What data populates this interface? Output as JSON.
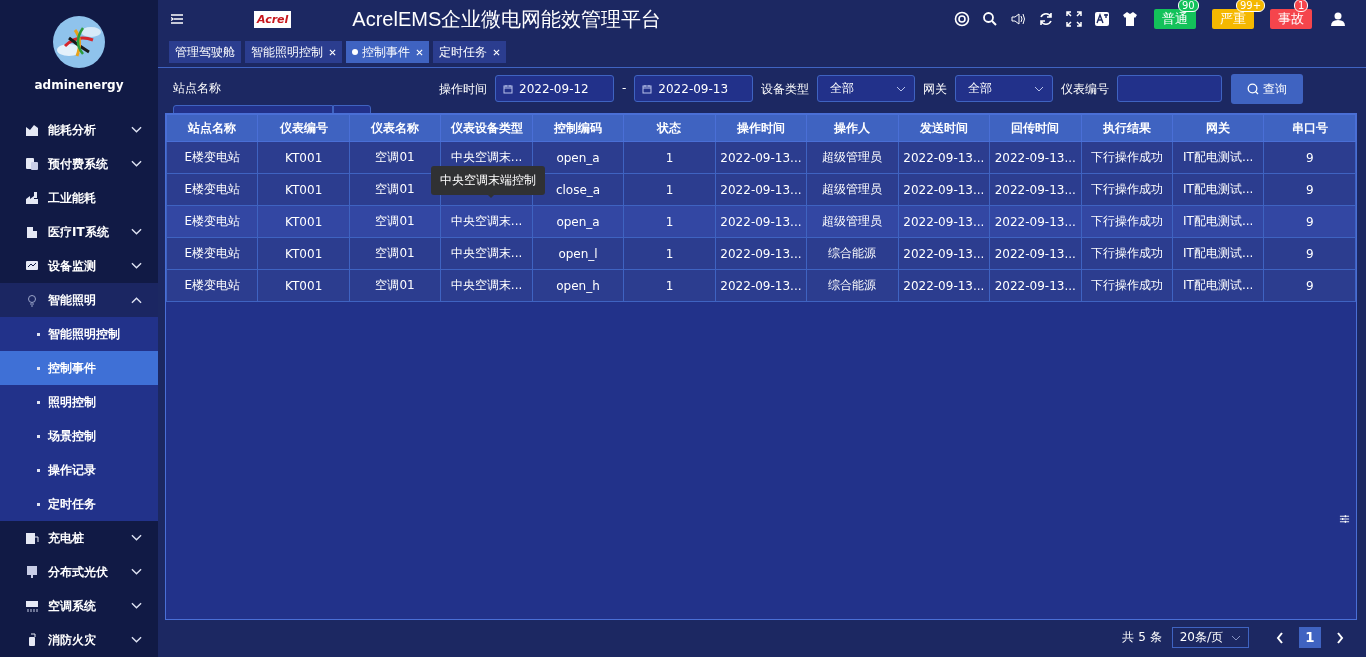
{
  "user": {
    "name": "adminenergy"
  },
  "menu": [
    {
      "label": "能耗分析",
      "expanded": false
    },
    {
      "label": "预付费系统",
      "expanded": false
    },
    {
      "label": "工业能耗"
    },
    {
      "label": "医疗IT系统",
      "expanded": false
    },
    {
      "label": "设备监测",
      "expanded": false
    },
    {
      "label": "智能照明",
      "expanded": true,
      "children": [
        {
          "label": "智能照明控制",
          "selected": false
        },
        {
          "label": "控制事件",
          "selected": true
        },
        {
          "label": "照明控制",
          "selected": false
        },
        {
          "label": "场景控制",
          "selected": false
        },
        {
          "label": "操作记录",
          "selected": false
        },
        {
          "label": "定时任务",
          "selected": false
        }
      ]
    },
    {
      "label": "充电桩",
      "expanded": false
    },
    {
      "label": "分布式光伏",
      "expanded": false
    },
    {
      "label": "空调系统",
      "expanded": false
    },
    {
      "label": "消防火灾",
      "expanded": false
    }
  ],
  "header": {
    "logo": "Acrel",
    "title": "AcrelEMS企业微电网能效管理平台",
    "alarms": [
      {
        "label": "普通",
        "count": "90",
        "color": "#13c25a"
      },
      {
        "label": "严重",
        "count": "99+",
        "color": "#f5b800"
      },
      {
        "label": "事故",
        "count": "1",
        "color": "#f5454c"
      }
    ]
  },
  "tabs": [
    {
      "label": "管理驾驶舱",
      "selected": false,
      "closable": false
    },
    {
      "label": "智能照明控制",
      "selected": false,
      "closable": true
    },
    {
      "label": "控制事件",
      "selected": true,
      "closable": true
    },
    {
      "label": "定时任务",
      "selected": false,
      "closable": true
    }
  ],
  "filters": {
    "station": {
      "label": "站点名称"
    },
    "time": {
      "label": "操作时间",
      "from": "2022-09-12",
      "separator": "-",
      "to": "2022-09-13"
    },
    "device_type": {
      "label": "设备类型",
      "value": "全部"
    },
    "gateway": {
      "label": "网关",
      "value": "全部"
    },
    "meter": {
      "label": "仪表编号"
    },
    "query_button": "查询"
  },
  "table": {
    "columns": [
      "站点名称",
      "仪表编号",
      "仪表名称",
      "仪表设备类型",
      "控制编码",
      "状态",
      "操作时间",
      "操作人",
      "发送时间",
      "回传时间",
      "执行结果",
      "网关",
      "串口号"
    ],
    "rows": [
      {
        "highlighted": false,
        "cells": [
          "E楼变电站",
          "KT001",
          "空调01",
          "中央空调末...",
          "open_a",
          "1",
          "2022-09-13...",
          "超级管理员",
          "2022-09-13...",
          "2022-09-13...",
          "下行操作成功",
          "IT配电测试...",
          "9"
        ]
      },
      {
        "highlighted": false,
        "cells": [
          "E楼变电站",
          "KT001",
          "空调01",
          null,
          "close_a",
          "1",
          "2022-09-13...",
          "超级管理员",
          "2022-09-13...",
          "2022-09-13...",
          "下行操作成功",
          "IT配电测试...",
          "9"
        ],
        "tooltip": "中央空调末端控制"
      },
      {
        "highlighted": true,
        "cells": [
          "E楼变电站",
          "KT001",
          "空调01",
          "中央空调末...",
          "open_a",
          "1",
          "2022-09-13...",
          "超级管理员",
          "2022-09-13...",
          "2022-09-13...",
          "下行操作成功",
          "IT配电测试...",
          "9"
        ]
      },
      {
        "highlighted": false,
        "cells": [
          "E楼变电站",
          "KT001",
          "空调01",
          "中央空调末...",
          "open_l",
          "1",
          "2022-09-13...",
          "综合能源",
          "2022-09-13...",
          "2022-09-13...",
          "下行操作成功",
          "IT配电测试...",
          "9"
        ]
      },
      {
        "highlighted": false,
        "cells": [
          "E楼变电站",
          "KT001",
          "空调01",
          "中央空调末...",
          "open_h",
          "1",
          "2022-09-13...",
          "综合能源",
          "2022-09-13...",
          "2022-09-13...",
          "下行操作成功",
          "IT配电测试...",
          "9"
        ]
      }
    ]
  },
  "pagination": {
    "total": "共 5 条",
    "page_size": "20条/页",
    "pages": [
      {
        "label": "1",
        "selected": true
      }
    ]
  }
}
